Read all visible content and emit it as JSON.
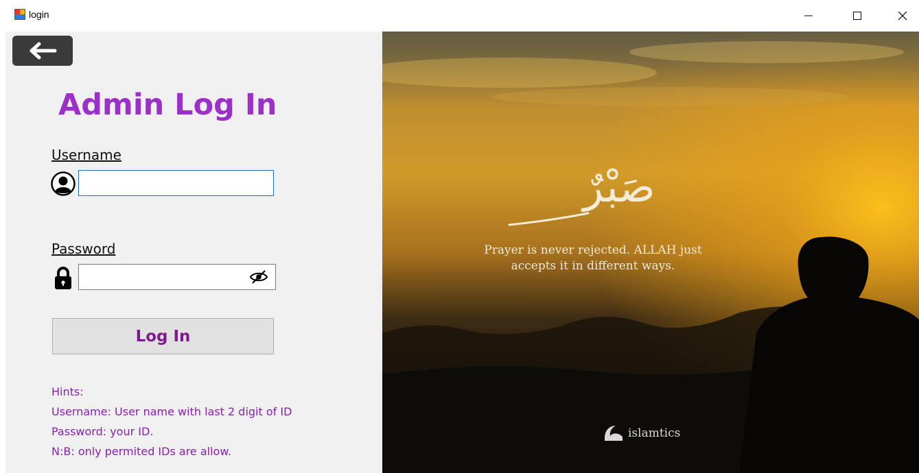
{
  "window": {
    "title": "login",
    "minimize": "—",
    "maximize": "☐",
    "close": "✕"
  },
  "header": {
    "back_icon": "arrow-left-icon",
    "title": "Admin Log In"
  },
  "form": {
    "username_label": "Username",
    "username_value": "",
    "username_icon": "user-circle-icon",
    "password_label": "Password",
    "password_value": "",
    "password_icon": "lock-icon",
    "eye_icon": "eye-slash-icon",
    "login_button": "Log In"
  },
  "hints": {
    "heading": "Hints:",
    "lines": [
      "Username: User name with last 2 digit of ID",
      "Password: your ID.",
      "N:B: only permited IDs are allow."
    ]
  },
  "hero": {
    "calligraphy": "صَبْرٌ",
    "quote_line1": "Prayer is never rejected. ALLAH just",
    "quote_line2": "accepts it in different ways.",
    "brand": "islamtics"
  },
  "colors": {
    "title_purple": "#9b30c9",
    "button_text": "#7c1a8e",
    "hint_purple": "#8a20b0",
    "input_focus_border": "#1a73c8"
  }
}
